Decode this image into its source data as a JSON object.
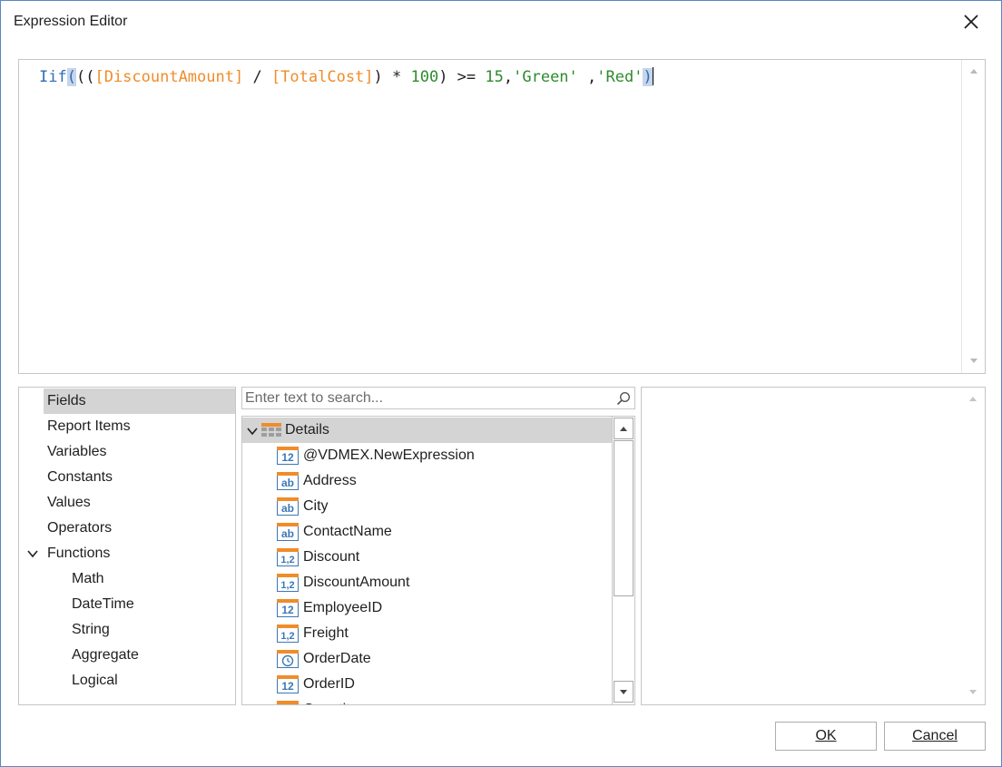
{
  "window": {
    "title": "Expression Editor"
  },
  "expression": {
    "tokens": [
      {
        "text": "Iif",
        "kind": "fn"
      },
      {
        "text": "(",
        "kind": "hl"
      },
      {
        "text": "((",
        "kind": "op"
      },
      {
        "text": "[DiscountAmount]",
        "kind": "field"
      },
      {
        "text": " / ",
        "kind": "op"
      },
      {
        "text": "[TotalCost]",
        "kind": "field"
      },
      {
        "text": ") * ",
        "kind": "op"
      },
      {
        "text": "100",
        "kind": "num"
      },
      {
        "text": ") >= ",
        "kind": "op"
      },
      {
        "text": "15",
        "kind": "num"
      },
      {
        "text": ",",
        "kind": "op"
      },
      {
        "text": "'Green'",
        "kind": "str"
      },
      {
        "text": " ,",
        "kind": "op"
      },
      {
        "text": "'Red'",
        "kind": "str"
      },
      {
        "text": ")",
        "kind": "hl"
      }
    ]
  },
  "categories": {
    "items": [
      {
        "label": "Fields",
        "selected": true
      },
      {
        "label": "Report Items"
      },
      {
        "label": "Variables"
      },
      {
        "label": "Constants"
      },
      {
        "label": "Values"
      },
      {
        "label": "Operators"
      },
      {
        "label": "Functions",
        "expanded": true
      },
      {
        "label": "Math",
        "child": true
      },
      {
        "label": "DateTime",
        "child": true
      },
      {
        "label": "String",
        "child": true
      },
      {
        "label": "Aggregate",
        "child": true
      },
      {
        "label": "Logical",
        "child": true
      }
    ]
  },
  "search": {
    "placeholder": "Enter text to search...",
    "value": ""
  },
  "tree": {
    "root_label": "Details",
    "fields": [
      {
        "label": "@VDMEX.NewExpression",
        "icon": "integer-icon",
        "glyph": "12"
      },
      {
        "label": "Address",
        "icon": "string-icon",
        "glyph": "ab"
      },
      {
        "label": "City",
        "icon": "string-icon",
        "glyph": "ab"
      },
      {
        "label": "ContactName",
        "icon": "string-icon",
        "glyph": "ab"
      },
      {
        "label": "Discount",
        "icon": "decimal-icon",
        "glyph": "1,2"
      },
      {
        "label": "DiscountAmount",
        "icon": "decimal-icon",
        "glyph": "1,2"
      },
      {
        "label": "EmployeeID",
        "icon": "integer-icon",
        "glyph": "12"
      },
      {
        "label": "Freight",
        "icon": "decimal-icon",
        "glyph": "1,2"
      },
      {
        "label": "OrderDate",
        "icon": "datetime-icon",
        "glyph": ""
      },
      {
        "label": "OrderID",
        "icon": "integer-icon",
        "glyph": "12"
      },
      {
        "label": "Quantity",
        "icon": "integer-icon",
        "glyph": "12"
      }
    ]
  },
  "buttons": {
    "ok": "OK",
    "cancel": "Cancel"
  },
  "colors": {
    "function": "#2f6db3",
    "field": "#f08c2a",
    "literal": "#2e8b2e",
    "icon_blue": "#3c78b5",
    "icon_orange": "#f08c2a",
    "selection": "#d4d4d4",
    "border": "#c6c6c6"
  }
}
